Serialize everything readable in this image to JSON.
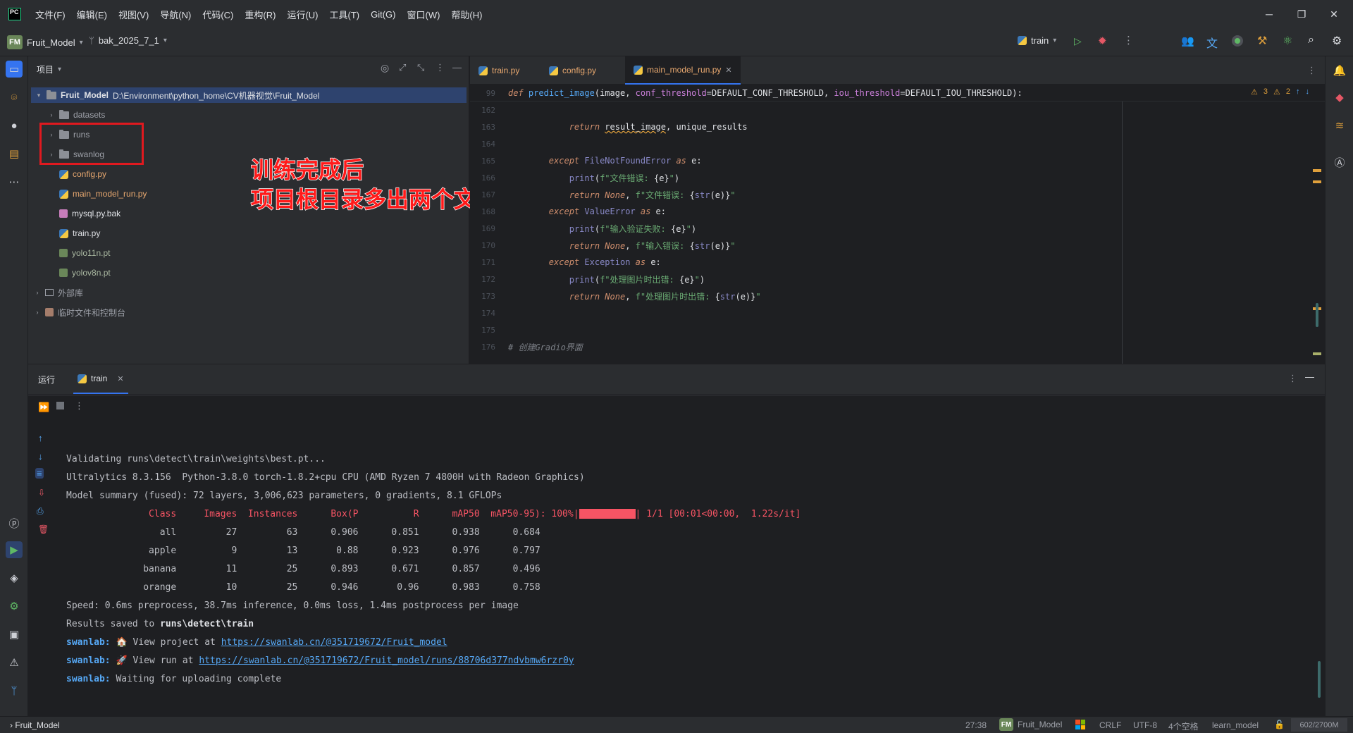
{
  "menu": [
    "文件(F)",
    "编辑(E)",
    "视图(V)",
    "导航(N)",
    "代码(C)",
    "重构(R)",
    "运行(U)",
    "工具(T)",
    "Git(G)",
    "窗口(W)",
    "帮助(H)"
  ],
  "toolbar": {
    "project_badge": "FM",
    "project_name": "Fruit_Model",
    "branch": "bak_2025_7_1",
    "run_config": "train"
  },
  "project_panel": {
    "title": "项目",
    "root_name": "Fruit_Model",
    "root_path": "D:\\Environment\\python_home\\CV机器视觉\\Fruit_Model",
    "items": [
      {
        "label": "datasets",
        "type": "folder"
      },
      {
        "label": "runs",
        "type": "folder"
      },
      {
        "label": "swanlog",
        "type": "folder"
      },
      {
        "label": "config.py",
        "type": "py"
      },
      {
        "label": "main_model_run.py",
        "type": "py"
      },
      {
        "label": "mysql.py.bak",
        "type": "bak"
      },
      {
        "label": "train.py",
        "type": "py"
      },
      {
        "label": "yolo11n.pt",
        "type": "pt"
      },
      {
        "label": "yolov8n.pt",
        "type": "pt"
      }
    ],
    "external_libs": "外部库",
    "scratches": "临时文件和控制台"
  },
  "annotation": {
    "line1": "训练完成后",
    "line2": "项目根目录多出两个文件夹"
  },
  "editor": {
    "tabs": [
      "train.py",
      "config.py",
      "main_model_run.py"
    ],
    "sticky_line_no": "99",
    "warn_count": "3",
    "weak_warn_count": "2",
    "line_numbers": [
      "162",
      "163",
      "164",
      "165",
      "166",
      "167",
      "168",
      "169",
      "170",
      "171",
      "172",
      "173",
      "174",
      "175",
      "176"
    ]
  },
  "run_panel": {
    "title": "运行",
    "tab": "train",
    "lines": {
      "validating": "Validating runs\\detect\\train\\weights\\best.pt...",
      "ultralytics": "Ultralytics 8.3.156  Python-3.8.0 torch-1.8.2+cpu CPU (AMD Ryzen 7 4800H with Radeon Graphics)",
      "summary": "Model summary (fused): 72 layers, 3,006,623 parameters, 0 gradients, 8.1 GFLOPs",
      "header": "                 Class     Images  Instances      Box(P          R      mAP50  mAP50-95): 100%|",
      "header_tail": "| 1/1 [00:01<00:00,  1.22s/it]",
      "rows": [
        "                   all         27         63      0.906      0.851      0.938      0.684",
        "                 apple          9         13       0.88      0.923      0.976      0.797",
        "                banana         11         25      0.893      0.671      0.857      0.496",
        "                orange         10         25      0.946       0.96      0.983      0.758"
      ],
      "speed": "Speed: 0.6ms preprocess, 38.7ms inference, 0.0ms loss, 1.4ms postprocess per image",
      "results_prefix": "Results saved to ",
      "results_path": "runs\\detect\\train",
      "swanlab_label": "swanlab:",
      "swan1_text": " 🏠 View project at ",
      "swan1_link": "https://swanlab.cn/@351719672/Fruit_model",
      "swan2_text": " 🚀 View run at ",
      "swan2_link": "https://swanlab.cn/@351719672/Fruit_model/runs/88706d377ndvbmw6rzr0y",
      "swan3_text": " Waiting for uploading complete"
    }
  },
  "statusbar": {
    "breadcrumb": "Fruit_Model",
    "position": "27:38",
    "project_badge": "FM",
    "project": "Fruit_Model",
    "line_sep": "CRLF",
    "encoding": "UTF-8",
    "indent": "4个空格",
    "interpreter": "learn_model",
    "memory": "602/2700M"
  },
  "colors": {
    "accent": "#3574f0",
    "annotation_red": "#e0191f",
    "console_red": "#f75464"
  }
}
